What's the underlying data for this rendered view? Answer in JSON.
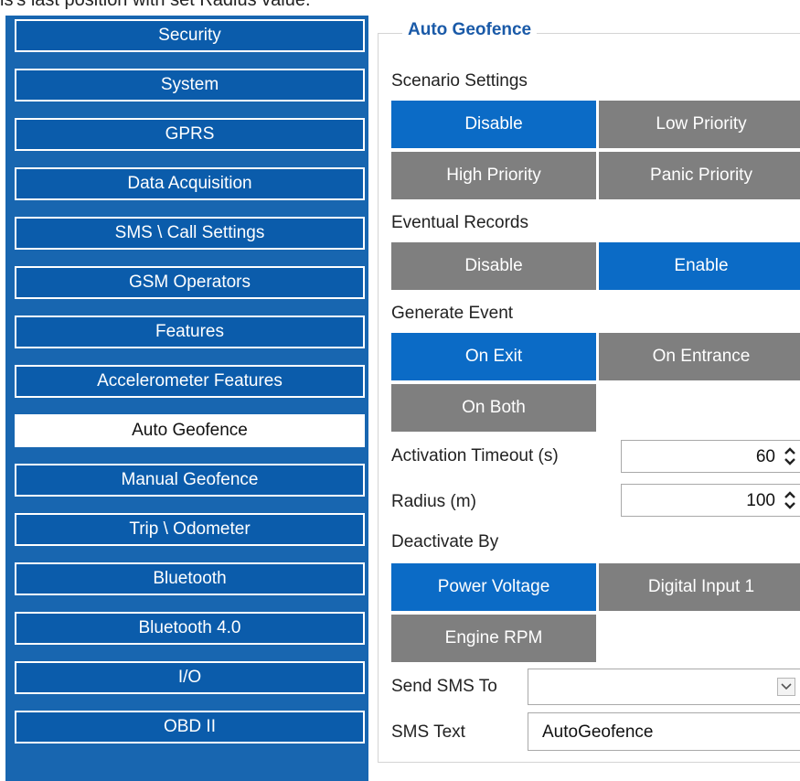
{
  "caption": "is's last position with set Radius value.",
  "sidebar": {
    "items": [
      {
        "label": "Security",
        "active": false
      },
      {
        "label": "System",
        "active": false
      },
      {
        "label": "GPRS",
        "active": false
      },
      {
        "label": "Data Acquisition",
        "active": false
      },
      {
        "label": "SMS \\ Call Settings",
        "active": false
      },
      {
        "label": "GSM Operators",
        "active": false
      },
      {
        "label": "Features",
        "active": false
      },
      {
        "label": "Accelerometer Features",
        "active": false
      },
      {
        "label": "Auto Geofence",
        "active": true
      },
      {
        "label": "Manual Geofence",
        "active": false
      },
      {
        "label": "Trip \\ Odometer",
        "active": false
      },
      {
        "label": "Bluetooth",
        "active": false
      },
      {
        "label": "Bluetooth 4.0",
        "active": false
      },
      {
        "label": "I/O",
        "active": false
      },
      {
        "label": "OBD II",
        "active": false
      }
    ]
  },
  "panel": {
    "title": "Auto Geofence",
    "scenario": {
      "label": "Scenario Settings",
      "options": [
        "Disable",
        "Low Priority",
        "High Priority",
        "Panic Priority"
      ],
      "selected": "Disable"
    },
    "eventual": {
      "label": "Eventual Records",
      "options": [
        "Disable",
        "Enable"
      ],
      "selected": "Enable"
    },
    "generate": {
      "label": "Generate Event",
      "options": [
        "On Exit",
        "On Entrance",
        "On Both"
      ],
      "selected": "On Exit"
    },
    "timeout": {
      "label": "Activation Timeout (s)",
      "value": "60"
    },
    "radius": {
      "label": "Radius (m)",
      "value": "100"
    },
    "deactivate": {
      "label": "Deactivate By",
      "options": [
        "Power Voltage",
        "Digital Input 1",
        "Engine RPM"
      ],
      "selected": "Power Voltage"
    },
    "send_sms": {
      "label": "Send SMS To",
      "value": ""
    },
    "sms_text": {
      "label": "SMS Text",
      "value": "AutoGeofence"
    }
  },
  "colors": {
    "accent": "#0b6bc6",
    "sidebar": "#1866b0",
    "inactive": "#7f7f7f",
    "title": "#1a5aa8"
  }
}
